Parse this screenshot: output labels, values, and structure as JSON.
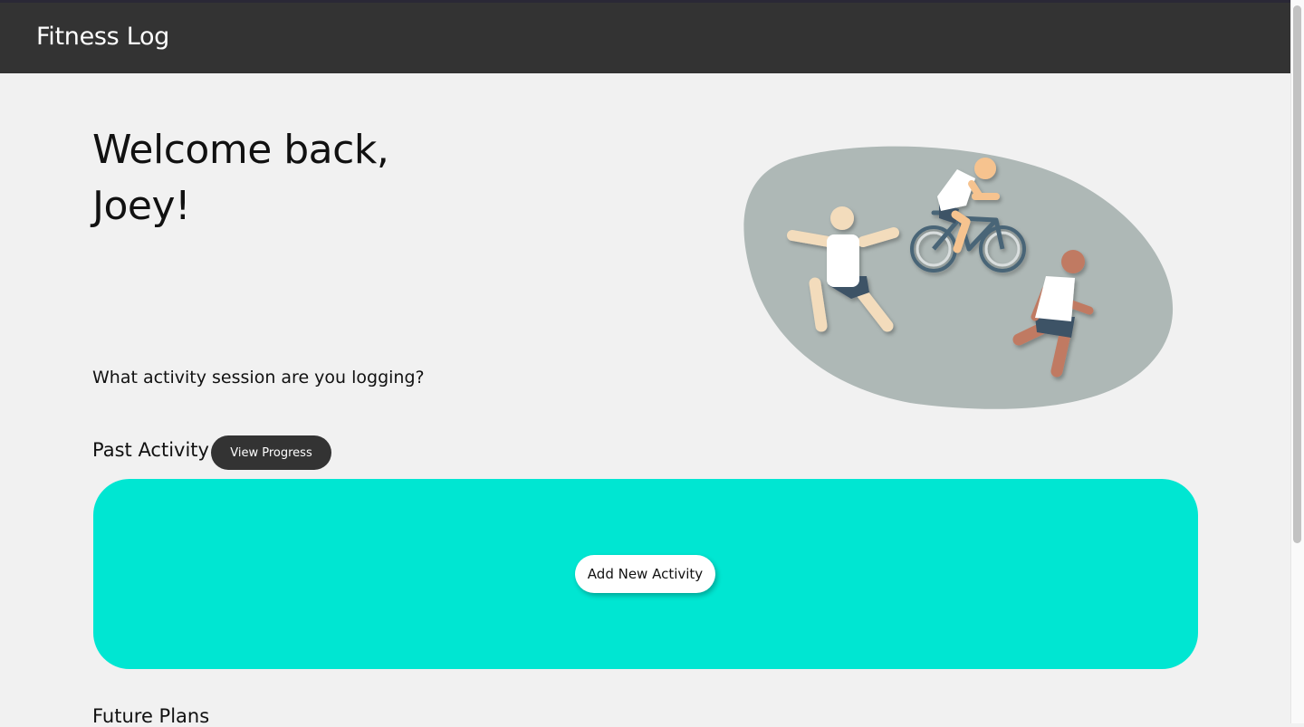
{
  "header": {
    "app_title": "Fitness Log",
    "background_color": "#333333"
  },
  "welcome": {
    "line1": "Welcome back,",
    "line2": "Joey!"
  },
  "illustration": {
    "description_icon": "sports-people-illustration",
    "blob_color": "#aeb8b6"
  },
  "prompt": "What activity session are you logging?",
  "past_activity": {
    "label": "Past Activity",
    "view_progress_label": "View Progress",
    "panel_color": "#00e6d2",
    "add_activity_label": "Add New Activity"
  },
  "future_plans": {
    "label": "Future Plans"
  }
}
